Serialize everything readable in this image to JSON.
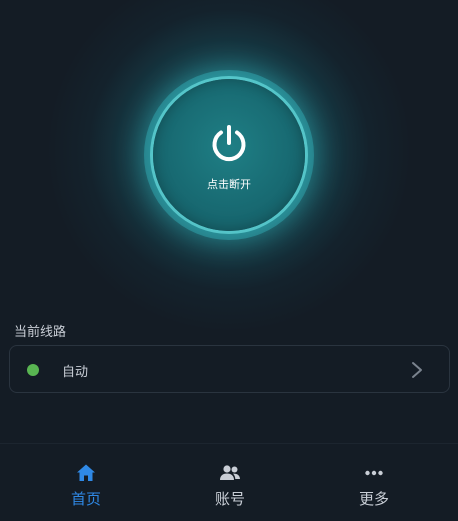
{
  "power_button": {
    "label": "点击断开",
    "icon": "power-icon"
  },
  "route_section": {
    "title": "当前线路",
    "selected_route": "自动",
    "status_color": "#59b552"
  },
  "bottom_nav": {
    "items": [
      {
        "label": "首页",
        "icon": "home-icon",
        "active": true
      },
      {
        "label": "账号",
        "icon": "users-icon",
        "active": false
      },
      {
        "label": "更多",
        "icon": "more-dots-icon",
        "active": false
      }
    ]
  },
  "colors": {
    "background": "#141c25",
    "accent": "#2f89e6",
    "nav_inactive": "#c9ced6",
    "glow": "#2cd6d8"
  }
}
